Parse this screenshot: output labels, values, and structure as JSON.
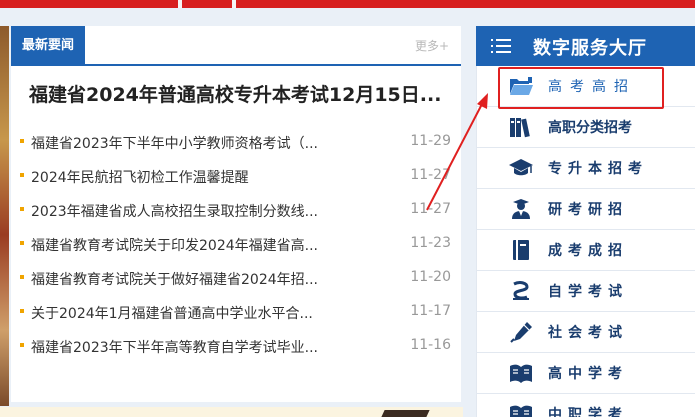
{
  "news": {
    "tab_label": "最新要闻",
    "more_label": "更多+",
    "headline": "福建省2024年普通高校专升本考试12月15日...",
    "items": [
      {
        "title": "福建省2023年下半年中小学教师资格考试（...",
        "date": "11-29"
      },
      {
        "title": "2024年民航招飞初检工作温馨提醒",
        "date": "11-27"
      },
      {
        "title": "2023年福建省成人高校招生录取控制分数线...",
        "date": "11-27"
      },
      {
        "title": "福建省教育考试院关于印发2024年福建省高...",
        "date": "11-23"
      },
      {
        "title": "福建省教育考试院关于做好福建省2024年招...",
        "date": "11-20"
      },
      {
        "title": "关于2024年1月福建省普通高中学业水平合...",
        "date": "11-17"
      },
      {
        "title": "福建省2023年下半年高等教育自学考试毕业...",
        "date": "11-16"
      }
    ]
  },
  "services": {
    "title": "数字服务大厅",
    "items": [
      {
        "label": "高考高招",
        "icon": "folder-open-icon"
      },
      {
        "label": "高职分类招考",
        "icon": "books-icon"
      },
      {
        "label": "专升本招考",
        "icon": "graduation-cap-icon"
      },
      {
        "label": "研考研招",
        "icon": "graduate-student-icon"
      },
      {
        "label": "成考成招",
        "icon": "book-icon"
      },
      {
        "label": "自学考试",
        "icon": "self-study-icon"
      },
      {
        "label": "社会考试",
        "icon": "pen-icon"
      },
      {
        "label": "高中学考",
        "icon": "open-book-icon"
      },
      {
        "label": "中职学考",
        "icon": "open-book-icon"
      }
    ]
  },
  "colors": {
    "primary_blue": "#1e63b3",
    "highlight_red": "#e02020",
    "bullet_orange": "#f0a400",
    "top_strip_red": "#d71f1f"
  }
}
